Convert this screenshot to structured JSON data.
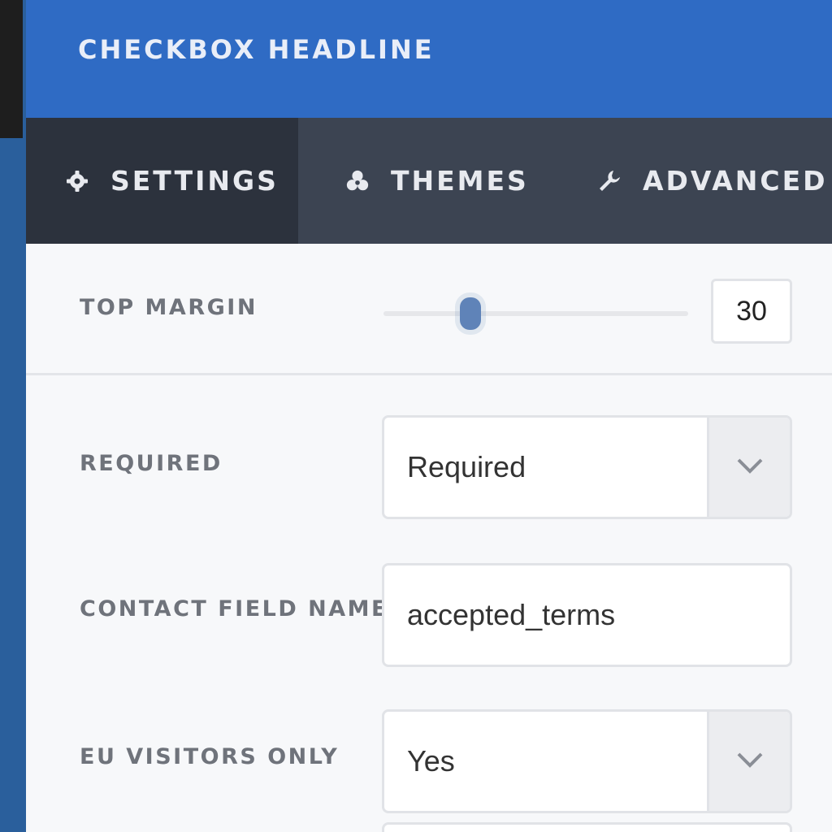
{
  "header": {
    "title": "CHECKBOX HEADLINE"
  },
  "tabs": [
    {
      "label": "SETTINGS",
      "icon": "gear-icon",
      "active": true
    },
    {
      "label": "THEMES",
      "icon": "palette-icon",
      "active": false
    },
    {
      "label": "ADVANCED",
      "icon": "wrench-icon",
      "active": false
    }
  ],
  "top_margin": {
    "label": "TOP MARGIN",
    "value": "30"
  },
  "fields": {
    "required": {
      "label": "REQUIRED",
      "value": "Required"
    },
    "contact_field_name": {
      "label": "CONTACT FIELD NAME",
      "value": "accepted_terms"
    },
    "eu_visitors_only": {
      "label": "EU VISITORS ONLY",
      "value": "Yes"
    }
  },
  "colors": {
    "header": "#2f6bc4",
    "tab_bar": "#3c4452",
    "tab_active": "#2c323d",
    "slider_thumb": "#5f83b8"
  }
}
